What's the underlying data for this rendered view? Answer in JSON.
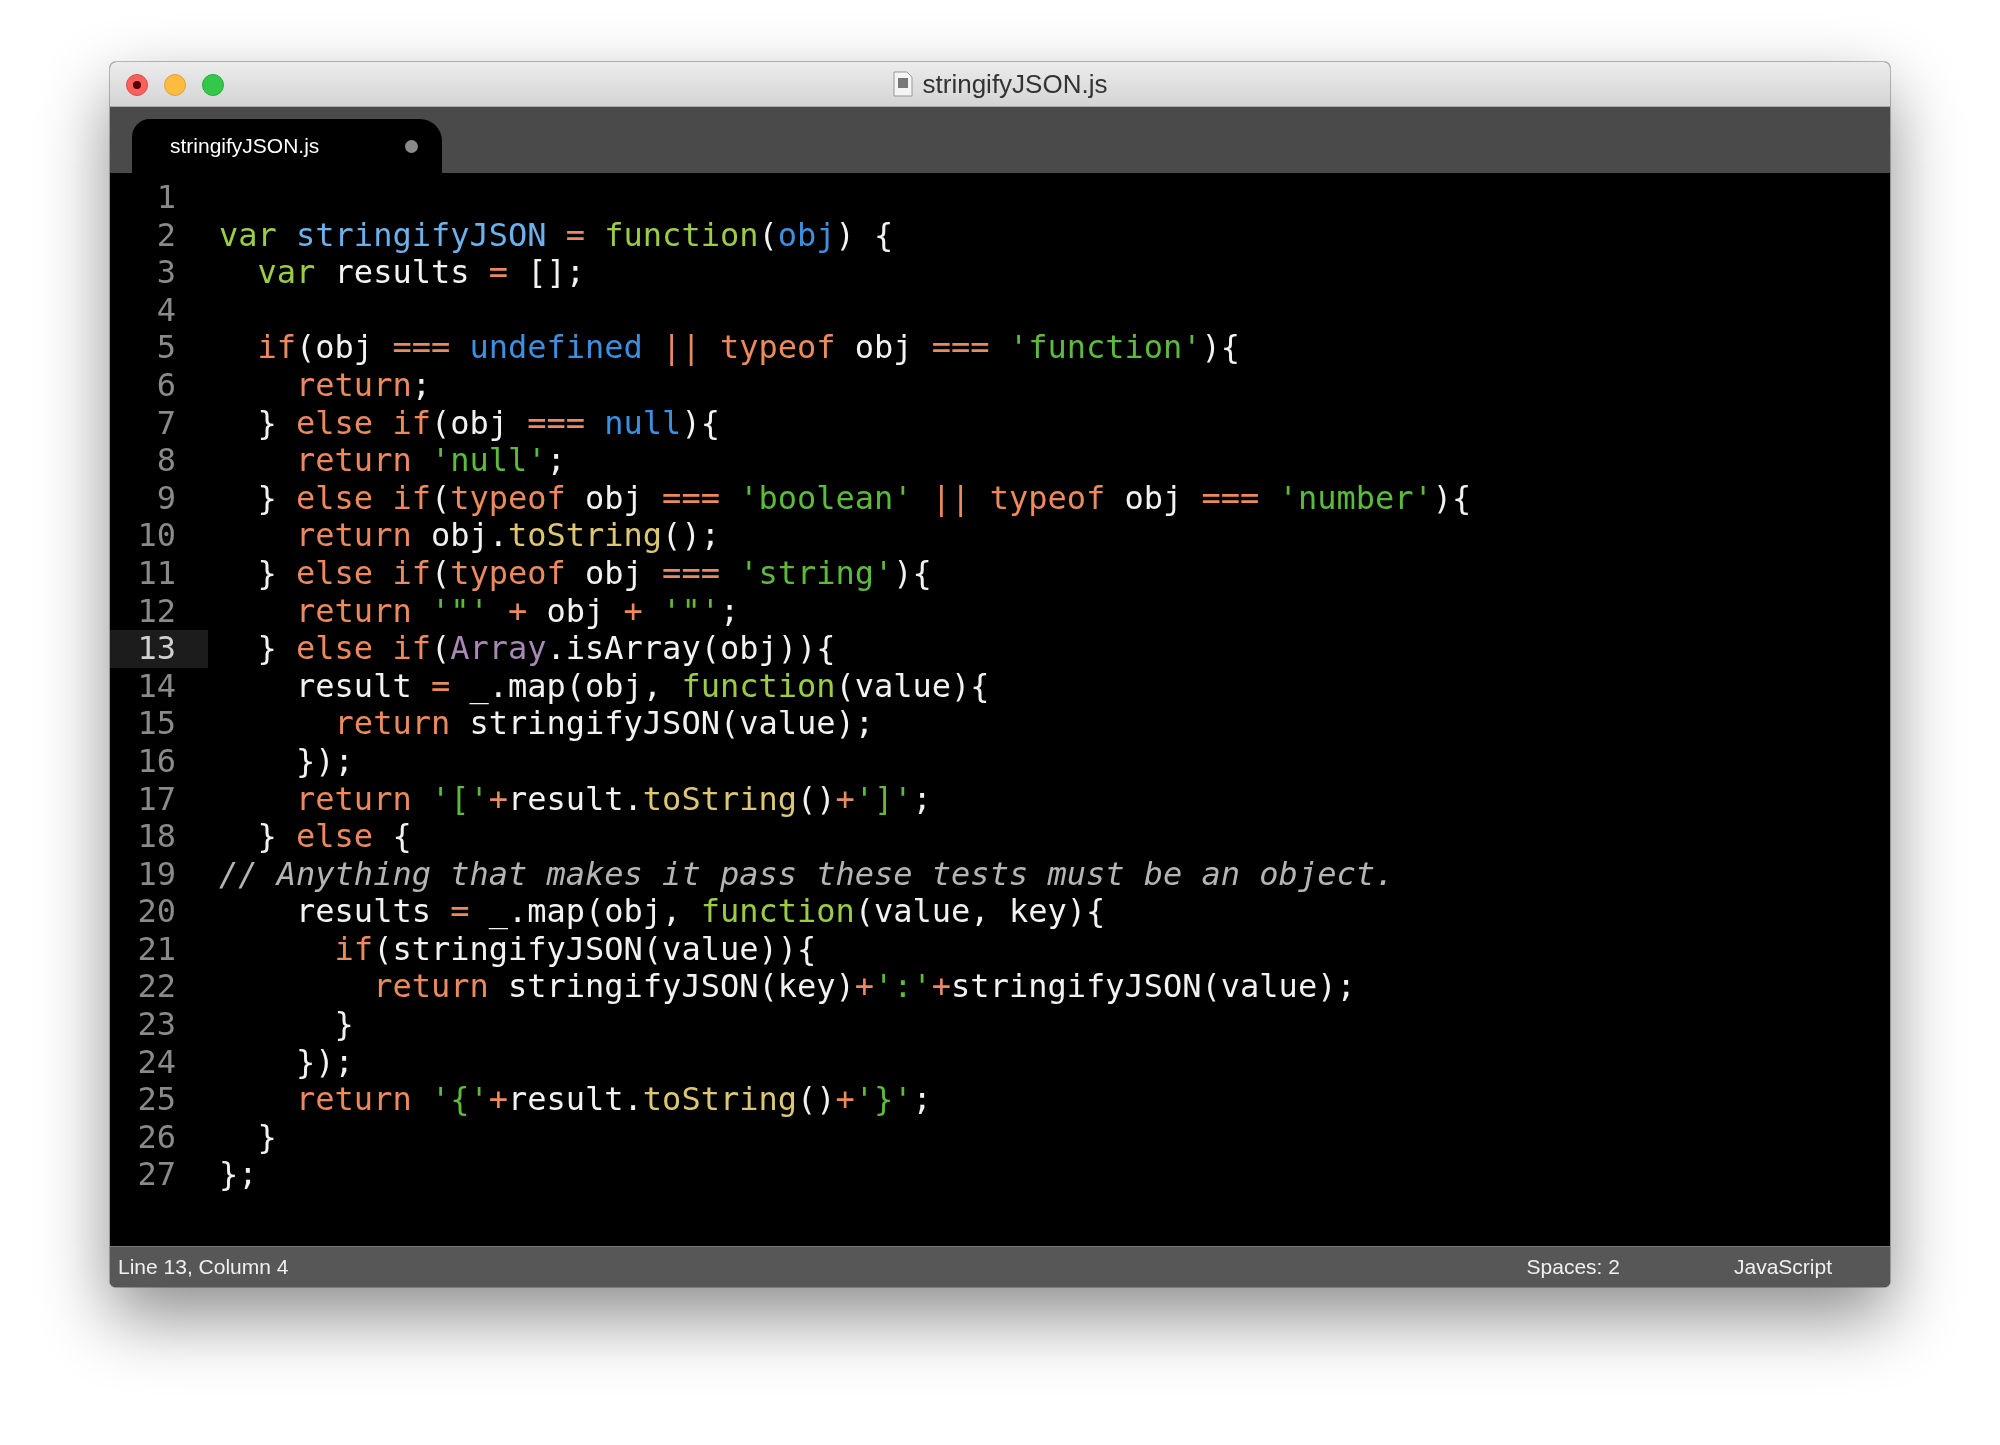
{
  "window": {
    "title": "stringifyJSON.js"
  },
  "tabs": [
    {
      "label": "stringifyJSON.js",
      "selected": true,
      "modified": true
    }
  ],
  "lines": [
    {
      "number": "1",
      "selected": false
    },
    {
      "number": "2",
      "selected": false,
      "tokens": [
        {
          "kind": "storage",
          "text": "var"
        },
        {
          "kind": "entity",
          "text": " stringifyJSON"
        },
        {
          "kind": "keyword",
          "text": " ="
        },
        {
          "kind": "storage",
          "text": " function"
        },
        {
          "kind": "plain",
          "text": "("
        },
        {
          "kind": "param",
          "text": "obj"
        },
        {
          "kind": "plain",
          "text": ") {"
        }
      ]
    },
    {
      "number": "3",
      "selected": false,
      "tokens": [
        {
          "kind": "storage",
          "text": "  var"
        },
        {
          "kind": "plain",
          "text": " results "
        },
        {
          "kind": "keyword",
          "text": "="
        },
        {
          "kind": "plain",
          "text": " [];"
        }
      ]
    },
    {
      "number": "4",
      "selected": false
    },
    {
      "number": "5",
      "selected": false,
      "tokens": [
        {
          "kind": "keyword",
          "text": "  if"
        },
        {
          "kind": "plain",
          "text": "(obj "
        },
        {
          "kind": "keyword",
          "text": "==="
        },
        {
          "kind": "constant",
          "text": " undefined"
        },
        {
          "kind": "keyword",
          "text": " ||"
        },
        {
          "kind": "keyword",
          "text": " typeof"
        },
        {
          "kind": "plain",
          "text": " obj "
        },
        {
          "kind": "keyword",
          "text": "==="
        },
        {
          "kind": "string",
          "text": " 'function'"
        },
        {
          "kind": "plain",
          "text": "){"
        }
      ]
    },
    {
      "number": "6",
      "selected": false,
      "tokens": [
        {
          "kind": "keyword",
          "text": "    return"
        },
        {
          "kind": "plain",
          "text": ";"
        }
      ]
    },
    {
      "number": "7",
      "selected": false,
      "tokens": [
        {
          "kind": "plain",
          "text": "  } "
        },
        {
          "kind": "keyword",
          "text": "else if"
        },
        {
          "kind": "plain",
          "text": "(obj "
        },
        {
          "kind": "keyword",
          "text": "==="
        },
        {
          "kind": "constant",
          "text": " null"
        },
        {
          "kind": "plain",
          "text": "){"
        }
      ]
    },
    {
      "number": "8",
      "selected": false,
      "tokens": [
        {
          "kind": "keyword",
          "text": "    return"
        },
        {
          "kind": "string",
          "text": " 'null'"
        },
        {
          "kind": "plain",
          "text": ";"
        }
      ]
    },
    {
      "number": "9",
      "selected": false,
      "tokens": [
        {
          "kind": "plain",
          "text": "  } "
        },
        {
          "kind": "keyword",
          "text": "else if"
        },
        {
          "kind": "plain",
          "text": "("
        },
        {
          "kind": "keyword",
          "text": "typeof"
        },
        {
          "kind": "plain",
          "text": " obj "
        },
        {
          "kind": "keyword",
          "text": "==="
        },
        {
          "kind": "string",
          "text": " 'boolean'"
        },
        {
          "kind": "keyword",
          "text": " ||"
        },
        {
          "kind": "keyword",
          "text": " typeof"
        },
        {
          "kind": "plain",
          "text": " obj "
        },
        {
          "kind": "keyword",
          "text": "==="
        },
        {
          "kind": "string",
          "text": " 'number'"
        },
        {
          "kind": "plain",
          "text": "){"
        }
      ]
    },
    {
      "number": "10",
      "selected": false,
      "tokens": [
        {
          "kind": "keyword",
          "text": "    return"
        },
        {
          "kind": "plain",
          "text": " obj."
        },
        {
          "kind": "method",
          "text": "toString"
        },
        {
          "kind": "plain",
          "text": "();"
        }
      ]
    },
    {
      "number": "11",
      "selected": false,
      "tokens": [
        {
          "kind": "plain",
          "text": "  } "
        },
        {
          "kind": "keyword",
          "text": "else if"
        },
        {
          "kind": "plain",
          "text": "("
        },
        {
          "kind": "keyword",
          "text": "typeof"
        },
        {
          "kind": "plain",
          "text": " obj "
        },
        {
          "kind": "keyword",
          "text": "==="
        },
        {
          "kind": "string",
          "text": " 'string'"
        },
        {
          "kind": "plain",
          "text": "){"
        }
      ]
    },
    {
      "number": "12",
      "selected": false,
      "tokens": [
        {
          "kind": "keyword",
          "text": "    return"
        },
        {
          "kind": "string",
          "text": " '\"'"
        },
        {
          "kind": "keyword",
          "text": " +"
        },
        {
          "kind": "plain",
          "text": " obj "
        },
        {
          "kind": "keyword",
          "text": "+"
        },
        {
          "kind": "string",
          "text": " '\"'"
        },
        {
          "kind": "plain",
          "text": ";"
        }
      ]
    },
    {
      "number": "13",
      "selected": true,
      "tokens": [
        {
          "kind": "plain",
          "text": "  } "
        },
        {
          "kind": "keyword",
          "text": "else if"
        },
        {
          "kind": "plain",
          "text": "("
        },
        {
          "kind": "class",
          "text": "Array"
        },
        {
          "kind": "plain",
          "text": ".isArray(obj)){"
        }
      ]
    },
    {
      "number": "14",
      "selected": false,
      "tokens": [
        {
          "kind": "plain",
          "text": "    result "
        },
        {
          "kind": "keyword",
          "text": "="
        },
        {
          "kind": "plain",
          "text": " _.map(obj, "
        },
        {
          "kind": "storage",
          "text": "function"
        },
        {
          "kind": "plain",
          "text": "(value){"
        }
      ]
    },
    {
      "number": "15",
      "selected": false,
      "tokens": [
        {
          "kind": "keyword",
          "text": "      return"
        },
        {
          "kind": "plain",
          "text": " stringifyJSON(value);"
        }
      ]
    },
    {
      "number": "16",
      "selected": false,
      "tokens": [
        {
          "kind": "plain",
          "text": "    });"
        }
      ]
    },
    {
      "number": "17",
      "selected": false,
      "tokens": [
        {
          "kind": "keyword",
          "text": "    return"
        },
        {
          "kind": "string",
          "text": " '['"
        },
        {
          "kind": "keyword",
          "text": "+"
        },
        {
          "kind": "plain",
          "text": "result."
        },
        {
          "kind": "method",
          "text": "toString"
        },
        {
          "kind": "plain",
          "text": "()"
        },
        {
          "kind": "keyword",
          "text": "+"
        },
        {
          "kind": "string",
          "text": "']'"
        },
        {
          "kind": "plain",
          "text": ";"
        }
      ]
    },
    {
      "number": "18",
      "selected": false,
      "tokens": [
        {
          "kind": "plain",
          "text": "  } "
        },
        {
          "kind": "keyword",
          "text": "else"
        },
        {
          "kind": "plain",
          "text": " {"
        }
      ]
    },
    {
      "number": "19",
      "selected": false,
      "tokens": [
        {
          "kind": "comment",
          "text": "// Anything that makes it pass these tests must be an object."
        }
      ]
    },
    {
      "number": "20",
      "selected": false,
      "tokens": [
        {
          "kind": "plain",
          "text": "    results "
        },
        {
          "kind": "keyword",
          "text": "="
        },
        {
          "kind": "plain",
          "text": " _.map(obj, "
        },
        {
          "kind": "storage",
          "text": "function"
        },
        {
          "kind": "plain",
          "text": "(value, key){"
        }
      ]
    },
    {
      "number": "21",
      "selected": false,
      "tokens": [
        {
          "kind": "keyword",
          "text": "      if"
        },
        {
          "kind": "plain",
          "text": "(stringifyJSON(value)){"
        }
      ]
    },
    {
      "number": "22",
      "selected": false,
      "tokens": [
        {
          "kind": "keyword",
          "text": "        return"
        },
        {
          "kind": "plain",
          "text": " stringifyJSON(key)"
        },
        {
          "kind": "keyword",
          "text": "+"
        },
        {
          "kind": "string",
          "text": "':'"
        },
        {
          "kind": "keyword",
          "text": "+"
        },
        {
          "kind": "plain",
          "text": "stringifyJSON(value);"
        }
      ]
    },
    {
      "number": "23",
      "selected": false,
      "tokens": [
        {
          "kind": "plain",
          "text": "      }"
        }
      ]
    },
    {
      "number": "24",
      "selected": false,
      "tokens": [
        {
          "kind": "plain",
          "text": "    });"
        }
      ]
    },
    {
      "number": "25",
      "selected": false,
      "tokens": [
        {
          "kind": "keyword",
          "text": "    return"
        },
        {
          "kind": "string",
          "text": " '{'"
        },
        {
          "kind": "keyword",
          "text": "+"
        },
        {
          "kind": "plain",
          "text": "result."
        },
        {
          "kind": "method",
          "text": "toString"
        },
        {
          "kind": "plain",
          "text": "()"
        },
        {
          "kind": "keyword",
          "text": "+"
        },
        {
          "kind": "string",
          "text": "'}'"
        },
        {
          "kind": "plain",
          "text": ";"
        }
      ]
    },
    {
      "number": "26",
      "selected": false,
      "tokens": [
        {
          "kind": "plain",
          "text": "  }"
        }
      ]
    },
    {
      "number": "27",
      "selected": false,
      "tokens": [
        {
          "kind": "plain",
          "text": "};"
        }
      ]
    }
  ],
  "status_bar": {
    "position": "Line 13, Column 4",
    "indentation": "Spaces: 2",
    "syntax": "JavaScript"
  }
}
